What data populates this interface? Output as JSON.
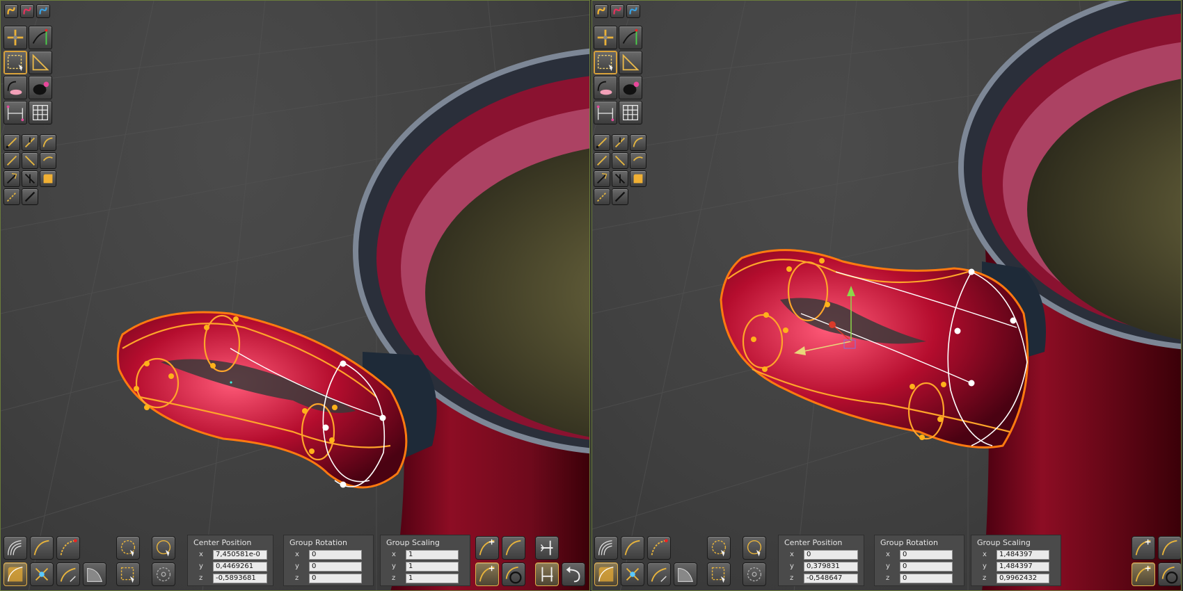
{
  "colors": {
    "accent": "#f58b1e",
    "object_red": "#a0102a",
    "grid_bg": "#444444",
    "viewport_border": "#6b7d3c"
  },
  "toolbar_icons": [
    "move-icon",
    "curve-transform-icon",
    "select-region-icon",
    "measure-icon",
    "lasso-icon",
    "brush-mask-icon",
    "curve-network-icon",
    "grid-icon"
  ],
  "bottom_icons": [
    "loft-icon",
    "sweep-icon",
    "curve-edit-icon",
    "fillet-icon",
    "snap-icon",
    "rotate-curve-icon",
    "shell-icon",
    "wedge-icon",
    "circle-select-icon",
    "rect-select-icon",
    "lasso-select-icon"
  ],
  "left": {
    "center_position": {
      "title": "Center Position",
      "x": "7,450581e-0",
      "y": "0,4469261",
      "z": "-0,5893681"
    },
    "group_rotation": {
      "title": "Group Rotation",
      "x": "0",
      "y": "0",
      "z": "0"
    },
    "group_scaling": {
      "title": "Group Scaling",
      "x": "1",
      "y": "1",
      "z": "1"
    }
  },
  "right": {
    "center_position": {
      "title": "Center Position",
      "x": "0",
      "y": "0,379831",
      "z": "-0,548647"
    },
    "group_rotation": {
      "title": "Group Rotation",
      "x": "0",
      "y": "0",
      "z": "0"
    },
    "group_scaling": {
      "title": "Group Scaling",
      "x": "1,484397",
      "y": "1,484397",
      "z": "0,9962432"
    }
  },
  "axis_labels": {
    "x": "x",
    "y": "y",
    "z": "z"
  }
}
